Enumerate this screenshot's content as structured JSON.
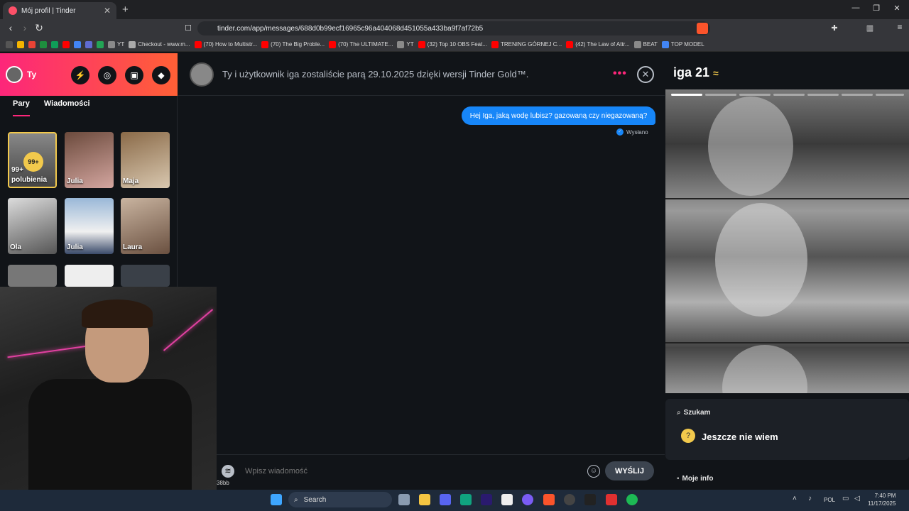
{
  "browser": {
    "tab_title": "Mój profil | Tinder",
    "tab_close": "✕",
    "new_tab": "+",
    "url": "tinder.com/app/messages/688d0b99ecf16965c96a404068d451055a433ba9f7af72b5",
    "window_minimize": "—",
    "window_restore": "❐",
    "window_close": "✕",
    "bookmarks": [
      {
        "label": "",
        "color": "#555"
      },
      {
        "label": "",
        "color": "#f5b400"
      },
      {
        "label": "",
        "color": "#ea4335"
      },
      {
        "label": "",
        "color": "#1e8e3e"
      },
      {
        "label": "",
        "color": "#0f9d58"
      },
      {
        "label": "",
        "color": "#ff0000"
      },
      {
        "label": "",
        "color": "#4285f4"
      },
      {
        "label": "",
        "color": "#5f6bd0"
      },
      {
        "label": "",
        "color": "#23a455"
      },
      {
        "label": "YT",
        "color": "#8a8a8a"
      },
      {
        "label": "Checkout - www.m...",
        "color": "#aaa"
      },
      {
        "label": "(70) How to Multistr...",
        "color": "#ff0000"
      },
      {
        "label": "(70) The Big Proble...",
        "color": "#ff0000"
      },
      {
        "label": "(70) The ULTIMATE...",
        "color": "#ff0000"
      },
      {
        "label": "YT",
        "color": "#8a8a8a"
      },
      {
        "label": "(32) Top 10 OBS Feat...",
        "color": "#ff0000"
      },
      {
        "label": "TRENING GÓRNEJ C...",
        "color": "#ff0000"
      },
      {
        "label": "(42) The Law of Attr...",
        "color": "#ff0000"
      },
      {
        "label": "BEAT",
        "color": "#8a8a8a"
      },
      {
        "label": "TOP MODEL",
        "color": "#4285f4"
      }
    ]
  },
  "sidebar": {
    "user_name": "Ty",
    "tabs": [
      "Pary",
      "Wiadomości"
    ],
    "likes_card": {
      "badge": "99+",
      "count": "99+",
      "label": "polubienia"
    },
    "matches": [
      "Julia",
      "Maja",
      "Ola",
      "Julia",
      "Laura"
    ]
  },
  "chat": {
    "header_text": "Ty i użytkownik iga zostaliście parą 29.10.2025 dzięki wersji Tinder Gold™.",
    "more_icon": "•••",
    "close_icon": "✕",
    "message": "Hej Iga, jaką wodę lubisz? gazowaną czy niegazowaną?",
    "status": "Wysłano",
    "input_placeholder": "Wpisz wiadomość",
    "send_label": "WYŚLIJ"
  },
  "webcam": {
    "label": "38bb"
  },
  "profile": {
    "name_age": "iga 21",
    "looking_for_label": "Szukam",
    "looking_for_value": "Jeszcze nie wiem",
    "more_info_label": "Moje info"
  },
  "taskbar": {
    "search_label": "Search",
    "language": "POL",
    "time": "7:40 PM",
    "date": "11/17/2025"
  },
  "colors": {
    "accent": "#fd267a",
    "bubble": "#1786f8",
    "background": "#111418"
  }
}
